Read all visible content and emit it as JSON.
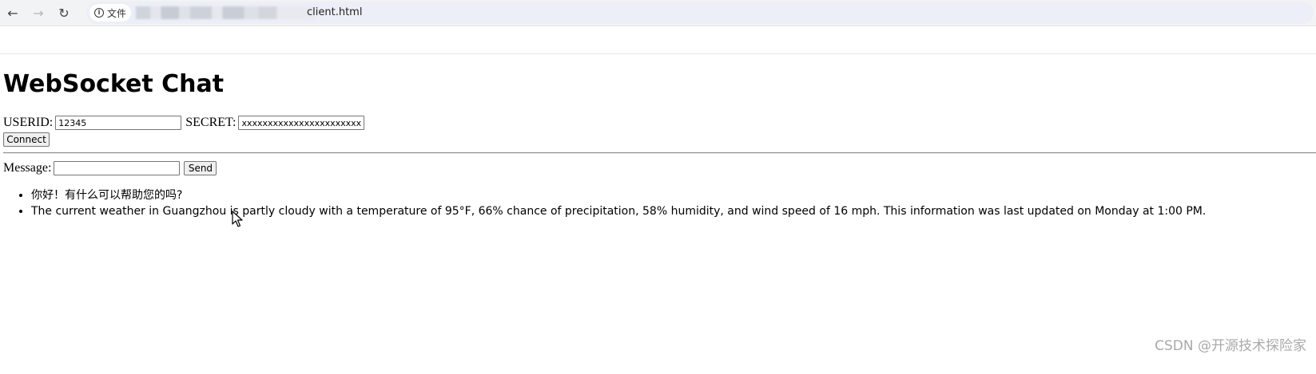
{
  "browser": {
    "back_icon": "arrow-left-icon",
    "forward_icon": "arrow-right-icon",
    "reload_icon": "reload-icon",
    "site_info_label": "文件",
    "url_visible": "client.html"
  },
  "page": {
    "title": "WebSocket Chat",
    "userid_label": "USERID:",
    "userid_value": "12345",
    "secret_label": "SECRET:",
    "secret_value": "xxxxxxxxxxxxxxxxxxxxxxxxxxxc",
    "connect_label": "Connect",
    "message_label": "Message:",
    "message_value": "",
    "send_label": "Send",
    "messages": [
      "你好！有什么可以帮助您的吗?",
      "The current weather in Guangzhou is partly cloudy with a temperature of 95°F, 66% chance of precipitation, 58% humidity, and wind speed of 16 mph. This information was last updated on Monday at 1:00 PM."
    ]
  },
  "watermark": "CSDN @开源技术探险家"
}
